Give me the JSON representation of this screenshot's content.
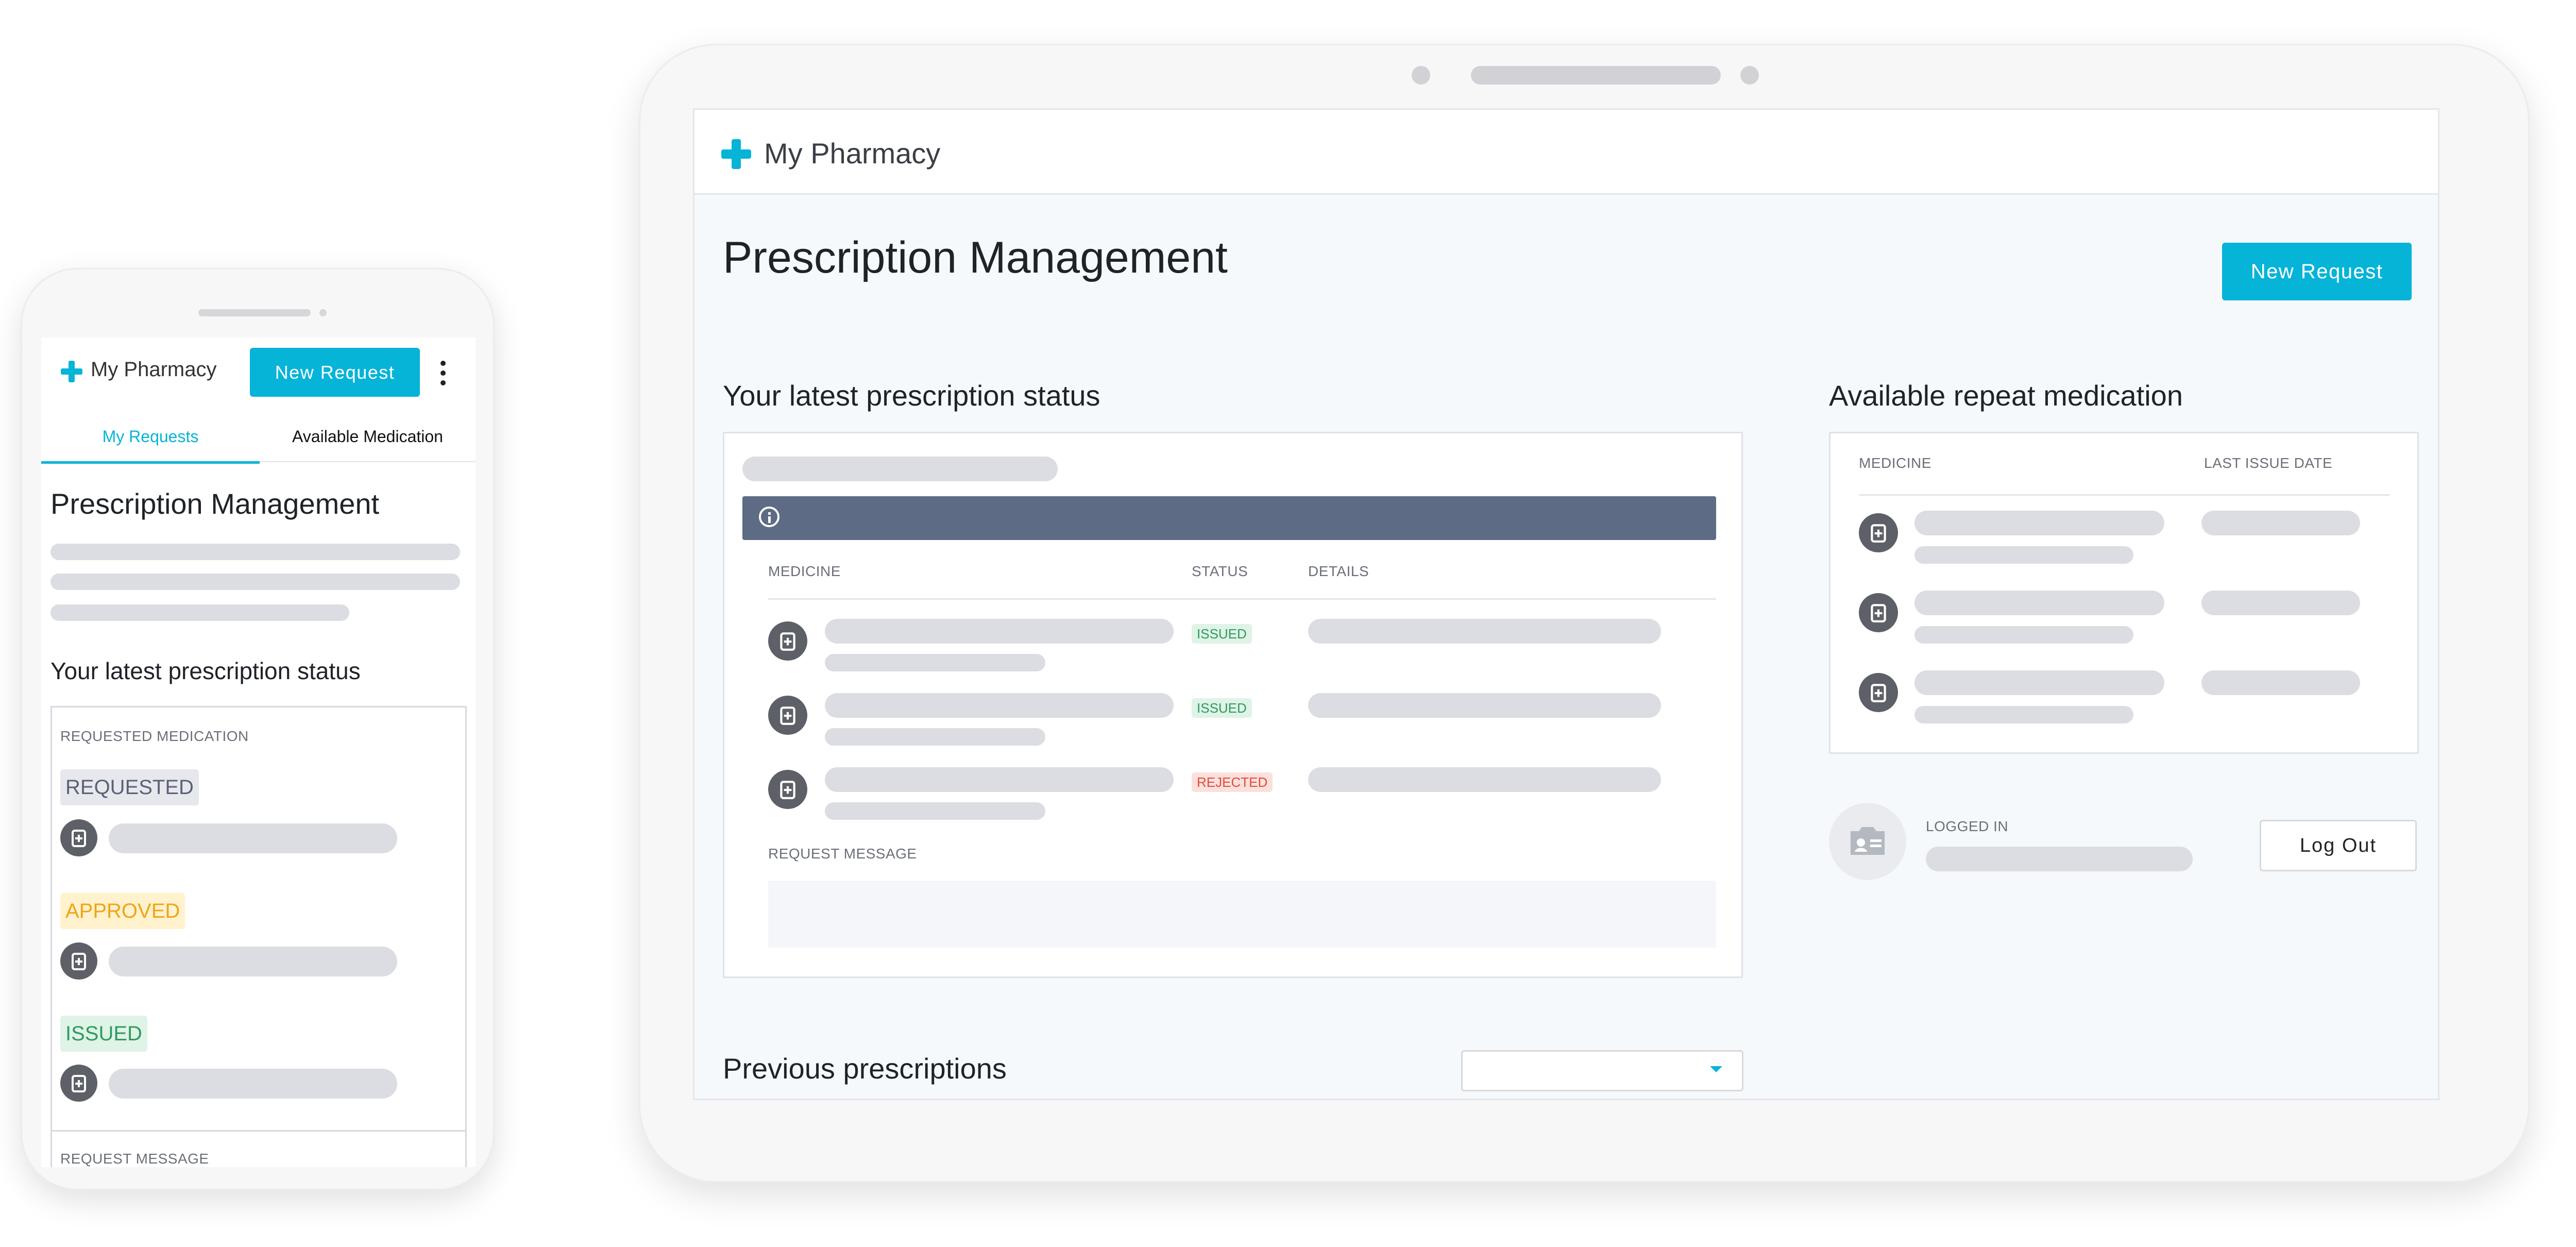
{
  "colors": {
    "accent": "#06b4d8",
    "banner": "#5d6b84",
    "issued_bg": "#dff3e7",
    "issued_fg": "#2e9b5f",
    "rejected_bg": "#fbe0dc",
    "rejected_fg": "#e04c3c",
    "requested_bg": "#e6e8ee",
    "requested_fg": "#5b6176",
    "approved_bg": "#fff2cc",
    "approved_fg": "#f1a417"
  },
  "phone": {
    "brand": "My Pharmacy",
    "new_request": "New Request",
    "tabs": [
      {
        "label": "My Requests",
        "active": true
      },
      {
        "label": "Available Medication",
        "active": false
      }
    ],
    "title": "Prescription Management",
    "latest_heading": "Your latest prescription status",
    "requested_medication_label": "REQUESTED MEDICATION",
    "statuses": [
      {
        "label": "REQUESTED",
        "icon": "medicine-bottle-icon"
      },
      {
        "label": "APPROVED",
        "icon": "medicine-bottle-icon"
      },
      {
        "label": "ISSUED",
        "icon": "medicine-bottle-icon"
      }
    ],
    "request_message_label": "REQUEST MESSAGE",
    "menu_icon": "kebab-menu-icon"
  },
  "tablet": {
    "brand": "My Pharmacy",
    "title": "Prescription Management",
    "new_request": "New Request",
    "latest": {
      "heading": "Your latest prescription status",
      "info_icon": "info-icon",
      "columns": [
        "MEDICINE",
        "STATUS",
        "DETAILS"
      ],
      "rows": [
        {
          "status": "ISSUED",
          "icon": "medicine-bottle-icon"
        },
        {
          "status": "ISSUED",
          "icon": "medicine-bottle-icon"
        },
        {
          "status": "REJECTED",
          "icon": "medicine-bottle-icon"
        }
      ],
      "request_message_label": "REQUEST MESSAGE"
    },
    "repeat": {
      "heading": "Available repeat medication",
      "columns": [
        "MEDICINE",
        "LAST ISSUE DATE"
      ],
      "rows": 3
    },
    "logged_in": {
      "label": "LOGGED IN",
      "icon": "user-id-card-icon",
      "logout": "Log Out"
    },
    "previous_heading": "Previous prescriptions",
    "dropdown_icon": "caret-down-icon"
  }
}
